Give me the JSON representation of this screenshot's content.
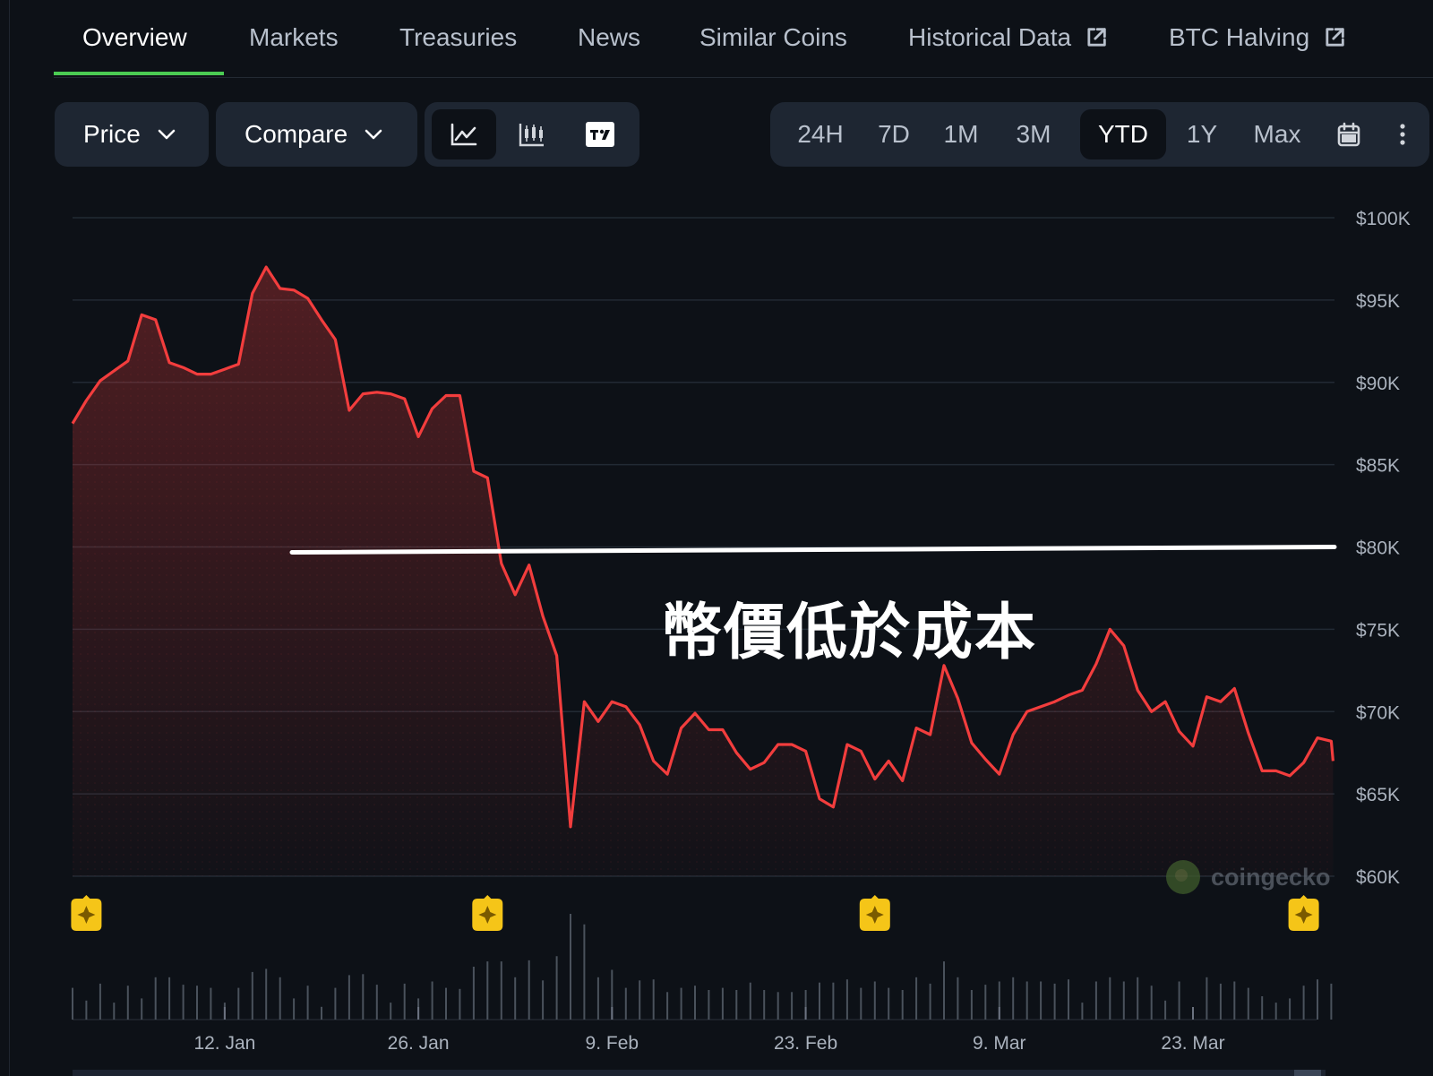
{
  "tabs": [
    {
      "label": "Overview",
      "active": true
    },
    {
      "label": "Markets"
    },
    {
      "label": "Treasuries"
    },
    {
      "label": "News"
    },
    {
      "label": "Similar Coins"
    },
    {
      "label": "Historical Data",
      "external": true
    },
    {
      "label": "BTC Halving",
      "external": true
    }
  ],
  "toolbar": {
    "price_label": "Price",
    "compare_label": "Compare",
    "view_modes": [
      "line-chart-icon",
      "candlestick-icon",
      "tradingview-icon"
    ],
    "active_view": "line-chart-icon",
    "ranges": [
      "24H",
      "7D",
      "1M",
      "3M",
      "YTD",
      "1Y",
      "Max"
    ],
    "active_range": "YTD",
    "calendar_icon": "calendar-icon",
    "more_icon": "more-vertical-icon"
  },
  "annotation": {
    "text": "幣價低於成本",
    "level": 80000,
    "color": "#ffffff"
  },
  "watermark": "coingecko",
  "colors": {
    "line": "#f23d3d",
    "accent_tab": "#4bcc53",
    "event_marker": "#f5c518"
  },
  "chart_data": {
    "type": "area",
    "ylim": [
      60000,
      100000
    ],
    "yticks": [
      100000,
      95000,
      90000,
      85000,
      80000,
      75000,
      70000,
      65000,
      60000
    ],
    "ytick_labels": [
      "$100K",
      "$95K",
      "$90K",
      "$85K",
      "$80K",
      "$75K",
      "$70K",
      "$65K",
      "$60K"
    ],
    "xlim": [
      "2026-01-01",
      "2026-04-01"
    ],
    "xticks": [
      "2026-01-12",
      "2026-01-26",
      "2026-02-09",
      "2026-02-23",
      "2026-03-09",
      "2026-03-23"
    ],
    "xtick_labels": [
      "12. Jan",
      "26. Jan",
      "9. Feb",
      "23. Feb",
      "9. Mar",
      "23. Mar"
    ],
    "series": [
      {
        "values": [
          [
            "2026-01-01",
            87500
          ],
          [
            "2026-01-02",
            88900
          ],
          [
            "2026-01-03",
            90100
          ],
          [
            "2026-01-04",
            90700
          ],
          [
            "2026-01-05",
            91300
          ],
          [
            "2026-01-06",
            94100
          ],
          [
            "2026-01-07",
            93800
          ],
          [
            "2026-01-08",
            91200
          ],
          [
            "2026-01-09",
            90900
          ],
          [
            "2026-01-10",
            90500
          ],
          [
            "2026-01-11",
            90500
          ],
          [
            "2026-01-12",
            90800
          ],
          [
            "2026-01-13",
            91100
          ],
          [
            "2026-01-14",
            95400
          ],
          [
            "2026-01-15",
            97000
          ],
          [
            "2026-01-16",
            95700
          ],
          [
            "2026-01-17",
            95600
          ],
          [
            "2026-01-18",
            95100
          ],
          [
            "2026-01-19",
            93800
          ],
          [
            "2026-01-20",
            92600
          ],
          [
            "2026-01-21",
            88300
          ],
          [
            "2026-01-22",
            89300
          ],
          [
            "2026-01-23",
            89400
          ],
          [
            "2026-01-24",
            89300
          ],
          [
            "2026-01-25",
            89000
          ],
          [
            "2026-01-26",
            86700
          ],
          [
            "2026-01-27",
            88400
          ],
          [
            "2026-01-28",
            89200
          ],
          [
            "2026-01-29",
            89200
          ],
          [
            "2026-01-30",
            84600
          ],
          [
            "2026-01-31",
            84200
          ],
          [
            "2026-02-01",
            79000
          ],
          [
            "2026-02-02",
            77100
          ],
          [
            "2026-02-03",
            78900
          ],
          [
            "2026-02-04",
            75800
          ],
          [
            "2026-02-05",
            73400
          ],
          [
            "2026-02-06",
            63000
          ],
          [
            "2026-02-07",
            70600
          ],
          [
            "2026-02-08",
            69400
          ],
          [
            "2026-02-09",
            70600
          ],
          [
            "2026-02-10",
            70300
          ],
          [
            "2026-02-11",
            69200
          ],
          [
            "2026-02-12",
            67000
          ],
          [
            "2026-02-13",
            66200
          ],
          [
            "2026-02-14",
            69000
          ],
          [
            "2026-02-15",
            69900
          ],
          [
            "2026-02-16",
            68900
          ],
          [
            "2026-02-17",
            68900
          ],
          [
            "2026-02-18",
            67500
          ],
          [
            "2026-02-19",
            66500
          ],
          [
            "2026-02-20",
            66900
          ],
          [
            "2026-02-21",
            68000
          ],
          [
            "2026-02-22",
            68000
          ],
          [
            "2026-02-23",
            67600
          ],
          [
            "2026-02-24",
            64700
          ],
          [
            "2026-02-25",
            64200
          ],
          [
            "2026-02-26",
            68000
          ],
          [
            "2026-02-27",
            67600
          ],
          [
            "2026-02-28",
            65900
          ],
          [
            "2026-03-01",
            67000
          ],
          [
            "2026-03-02",
            65800
          ],
          [
            "2026-03-03",
            69000
          ],
          [
            "2026-03-04",
            68600
          ],
          [
            "2026-03-05",
            72800
          ],
          [
            "2026-03-06",
            70800
          ],
          [
            "2026-03-07",
            68100
          ],
          [
            "2026-03-08",
            67100
          ],
          [
            "2026-03-09",
            66200
          ],
          [
            "2026-03-10",
            68600
          ],
          [
            "2026-03-11",
            70000
          ],
          [
            "2026-03-12",
            70300
          ],
          [
            "2026-03-13",
            70600
          ],
          [
            "2026-03-14",
            71000
          ],
          [
            "2026-03-15",
            71300
          ],
          [
            "2026-03-16",
            72900
          ],
          [
            "2026-03-17",
            75000
          ],
          [
            "2026-03-18",
            74000
          ],
          [
            "2026-03-19",
            71300
          ],
          [
            "2026-03-20",
            70000
          ],
          [
            "2026-03-21",
            70600
          ],
          [
            "2026-03-22",
            68800
          ],
          [
            "2026-03-23",
            67900
          ],
          [
            "2026-03-24",
            70900
          ],
          [
            "2026-03-25",
            70600
          ],
          [
            "2026-03-26",
            71400
          ],
          [
            "2026-03-27",
            68700
          ],
          [
            "2026-03-28",
            66400
          ],
          [
            "2026-03-29",
            66400
          ],
          [
            "2026-03-30",
            66100
          ],
          [
            "2026-03-31",
            66900
          ],
          [
            "2026-04-01",
            68400
          ],
          [
            "2026-04-02",
            68200
          ],
          [
            "2026-04-02",
            67000
          ]
        ]
      }
    ],
    "volume": [
      [
        "2026-01-01",
        0.3
      ],
      [
        "2026-01-02",
        0.18
      ],
      [
        "2026-01-03",
        0.34
      ],
      [
        "2026-01-04",
        0.16
      ],
      [
        "2026-01-05",
        0.32
      ],
      [
        "2026-01-06",
        0.2
      ],
      [
        "2026-01-07",
        0.4
      ],
      [
        "2026-01-08",
        0.4
      ],
      [
        "2026-01-09",
        0.33
      ],
      [
        "2026-01-10",
        0.32
      ],
      [
        "2026-01-11",
        0.3
      ],
      [
        "2026-01-12",
        0.16
      ],
      [
        "2026-01-13",
        0.3
      ],
      [
        "2026-01-14",
        0.45
      ],
      [
        "2026-01-15",
        0.48
      ],
      [
        "2026-01-16",
        0.4
      ],
      [
        "2026-01-17",
        0.2
      ],
      [
        "2026-01-18",
        0.32
      ],
      [
        "2026-01-19",
        0.12
      ],
      [
        "2026-01-20",
        0.3
      ],
      [
        "2026-01-21",
        0.42
      ],
      [
        "2026-01-22",
        0.43
      ],
      [
        "2026-01-23",
        0.33
      ],
      [
        "2026-01-24",
        0.16
      ],
      [
        "2026-01-25",
        0.34
      ],
      [
        "2026-01-26",
        0.2
      ],
      [
        "2026-01-27",
        0.36
      ],
      [
        "2026-01-28",
        0.3
      ],
      [
        "2026-01-29",
        0.29
      ],
      [
        "2026-01-30",
        0.5
      ],
      [
        "2026-01-31",
        0.55
      ],
      [
        "2026-02-01",
        0.55
      ],
      [
        "2026-02-02",
        0.4
      ],
      [
        "2026-02-03",
        0.56
      ],
      [
        "2026-02-04",
        0.37
      ],
      [
        "2026-02-05",
        0.6
      ],
      [
        "2026-02-06",
        1.0
      ],
      [
        "2026-02-07",
        0.9
      ],
      [
        "2026-02-08",
        0.4
      ],
      [
        "2026-02-09",
        0.47
      ],
      [
        "2026-02-10",
        0.3
      ],
      [
        "2026-02-11",
        0.37
      ],
      [
        "2026-02-12",
        0.38
      ],
      [
        "2026-02-13",
        0.26
      ],
      [
        "2026-02-14",
        0.3
      ],
      [
        "2026-02-15",
        0.32
      ],
      [
        "2026-02-16",
        0.28
      ],
      [
        "2026-02-17",
        0.3
      ],
      [
        "2026-02-18",
        0.28
      ],
      [
        "2026-02-19",
        0.35
      ],
      [
        "2026-02-20",
        0.28
      ],
      [
        "2026-02-21",
        0.26
      ],
      [
        "2026-02-22",
        0.26
      ],
      [
        "2026-02-23",
        0.28
      ],
      [
        "2026-02-24",
        0.35
      ],
      [
        "2026-02-25",
        0.35
      ],
      [
        "2026-02-26",
        0.38
      ],
      [
        "2026-02-27",
        0.3
      ],
      [
        "2026-02-28",
        0.36
      ],
      [
        "2026-03-01",
        0.3
      ],
      [
        "2026-03-02",
        0.28
      ],
      [
        "2026-03-03",
        0.4
      ],
      [
        "2026-03-04",
        0.34
      ],
      [
        "2026-03-05",
        0.55
      ],
      [
        "2026-03-06",
        0.4
      ],
      [
        "2026-03-07",
        0.28
      ],
      [
        "2026-03-08",
        0.33
      ],
      [
        "2026-03-09",
        0.36
      ],
      [
        "2026-03-10",
        0.4
      ],
      [
        "2026-03-11",
        0.36
      ],
      [
        "2026-03-12",
        0.36
      ],
      [
        "2026-03-13",
        0.34
      ],
      [
        "2026-03-14",
        0.38
      ],
      [
        "2026-03-15",
        0.16
      ],
      [
        "2026-03-16",
        0.36
      ],
      [
        "2026-03-17",
        0.4
      ],
      [
        "2026-03-18",
        0.36
      ],
      [
        "2026-03-19",
        0.4
      ],
      [
        "2026-03-20",
        0.32
      ],
      [
        "2026-03-21",
        0.18
      ],
      [
        "2026-03-22",
        0.36
      ],
      [
        "2026-03-23",
        0.1
      ],
      [
        "2026-03-24",
        0.4
      ],
      [
        "2026-03-25",
        0.34
      ],
      [
        "2026-03-26",
        0.36
      ],
      [
        "2026-03-27",
        0.3
      ],
      [
        "2026-03-28",
        0.22
      ],
      [
        "2026-03-29",
        0.16
      ],
      [
        "2026-03-30",
        0.2
      ],
      [
        "2026-03-31",
        0.32
      ],
      [
        "2026-04-01",
        0.38
      ],
      [
        "2026-04-02",
        0.34
      ]
    ],
    "event_markers": [
      "2026-01-02",
      "2026-01-31",
      "2026-02-28",
      "2026-03-31"
    ],
    "grid": true
  }
}
